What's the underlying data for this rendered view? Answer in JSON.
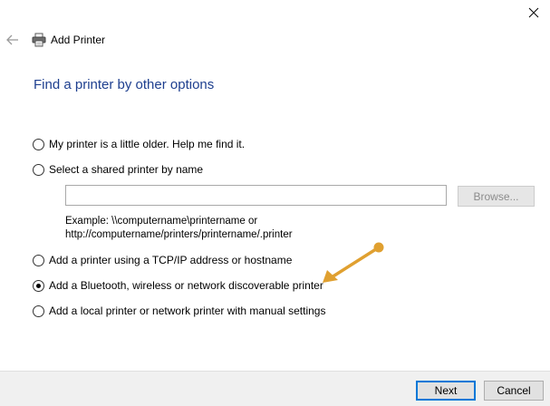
{
  "window": {
    "title": "Add Printer"
  },
  "heading": "Find a printer by other options",
  "options": [
    {
      "label": "My printer is a little older. Help me find it.",
      "checked": false
    },
    {
      "label": "Select a shared printer by name",
      "checked": false
    },
    {
      "label": "Add a printer using a TCP/IP address or hostname",
      "checked": false
    },
    {
      "label": "Add a Bluetooth, wireless or network discoverable printer",
      "checked": true
    },
    {
      "label": "Add a local printer or network printer with manual settings",
      "checked": false
    }
  ],
  "shared_printer": {
    "input_value": "",
    "browse_label": "Browse...",
    "example_line1": "Example: \\\\computername\\printername or",
    "example_line2": "http://computername/printers/printername/.printer"
  },
  "buttons": {
    "next": "Next",
    "cancel": "Cancel"
  },
  "colors": {
    "heading": "#1e3f8f",
    "annotation_arrow": "#e0a030",
    "footer_bg": "#f0f0f0",
    "accent": "#0078d7"
  }
}
